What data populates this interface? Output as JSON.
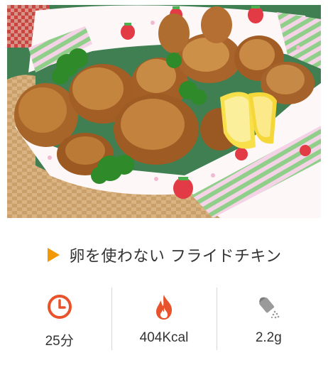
{
  "recipe": {
    "title": "卵を使わない フライドチキン"
  },
  "stats": [
    {
      "icon": "clock-icon",
      "value": "25分"
    },
    {
      "icon": "flame-icon",
      "value": "404Kcal"
    },
    {
      "icon": "salt-shaker-icon",
      "value": "2.2g"
    }
  ],
  "colors": {
    "accent": "#f39800",
    "icon_red": "#e8532b",
    "icon_gray": "#9a9a9a",
    "divider": "#d7d7d7"
  }
}
